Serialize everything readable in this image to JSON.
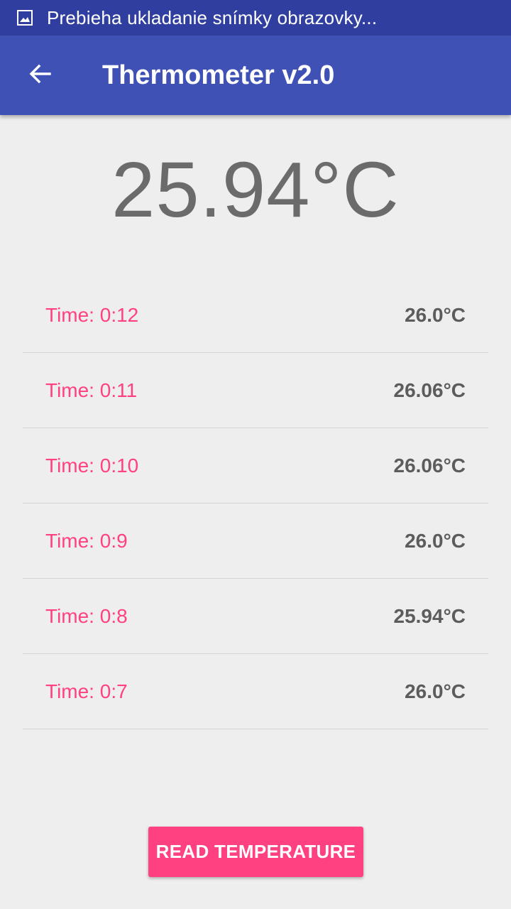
{
  "status_bar": {
    "icon": "image-icon",
    "text": "Prebieha ukladanie snímky obrazovky..."
  },
  "app_bar": {
    "back_icon": "arrow-back-icon",
    "title": "Thermometer v2.0"
  },
  "current_temperature": "25.94°C",
  "readings": [
    {
      "time": "Time: 0:12",
      "value": "26.0°C"
    },
    {
      "time": "Time: 0:11",
      "value": "26.06°C"
    },
    {
      "time": "Time: 0:10",
      "value": "26.06°C"
    },
    {
      "time": "Time: 0:9",
      "value": "26.0°C"
    },
    {
      "time": "Time: 0:8",
      "value": "25.94°C"
    },
    {
      "time": "Time: 0:7",
      "value": "26.0°C"
    }
  ],
  "read_button_label": "READ TEMPERATURE",
  "colors": {
    "status_bar": "#303f9f",
    "app_bar": "#3f51b5",
    "accent": "#ff4081",
    "background": "#eeeeee"
  }
}
